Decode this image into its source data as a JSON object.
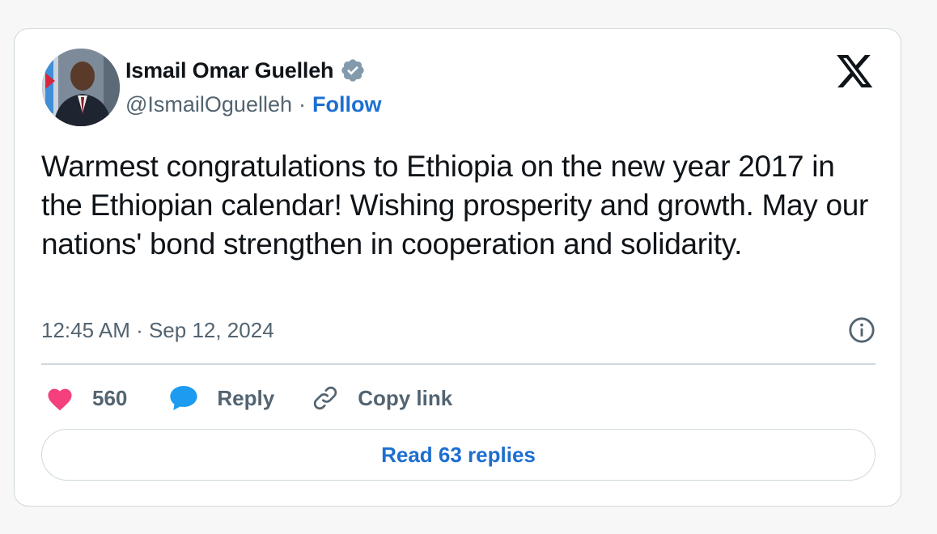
{
  "author": {
    "name": "Ismail Omar Guelleh",
    "handle": "@IsmailOguelleh",
    "separator": "·",
    "follow_label": "Follow",
    "verified_icon": "verified-badge-icon",
    "verified_color": "#829aab"
  },
  "brand": {
    "logo_icon": "x-logo-icon"
  },
  "tweet": {
    "text": "Warmest congratulations to Ethiopia on the new year 2017 in the Ethiopian calendar! Wishing prosperity and growth. May our nations' bond strengthen in cooperation and solidarity.",
    "timestamp": "12:45 AM · Sep 12, 2024"
  },
  "actions": {
    "like_count": "560",
    "reply_label": "Reply",
    "copy_link_label": "Copy link"
  },
  "footer": {
    "read_replies_label": "Read 63 replies"
  },
  "colors": {
    "link_blue": "#1d6fd0",
    "like_pink": "#f4407d",
    "reply_blue": "#1d9bf0",
    "secondary_text": "#536471",
    "border": "#cfd9de"
  }
}
